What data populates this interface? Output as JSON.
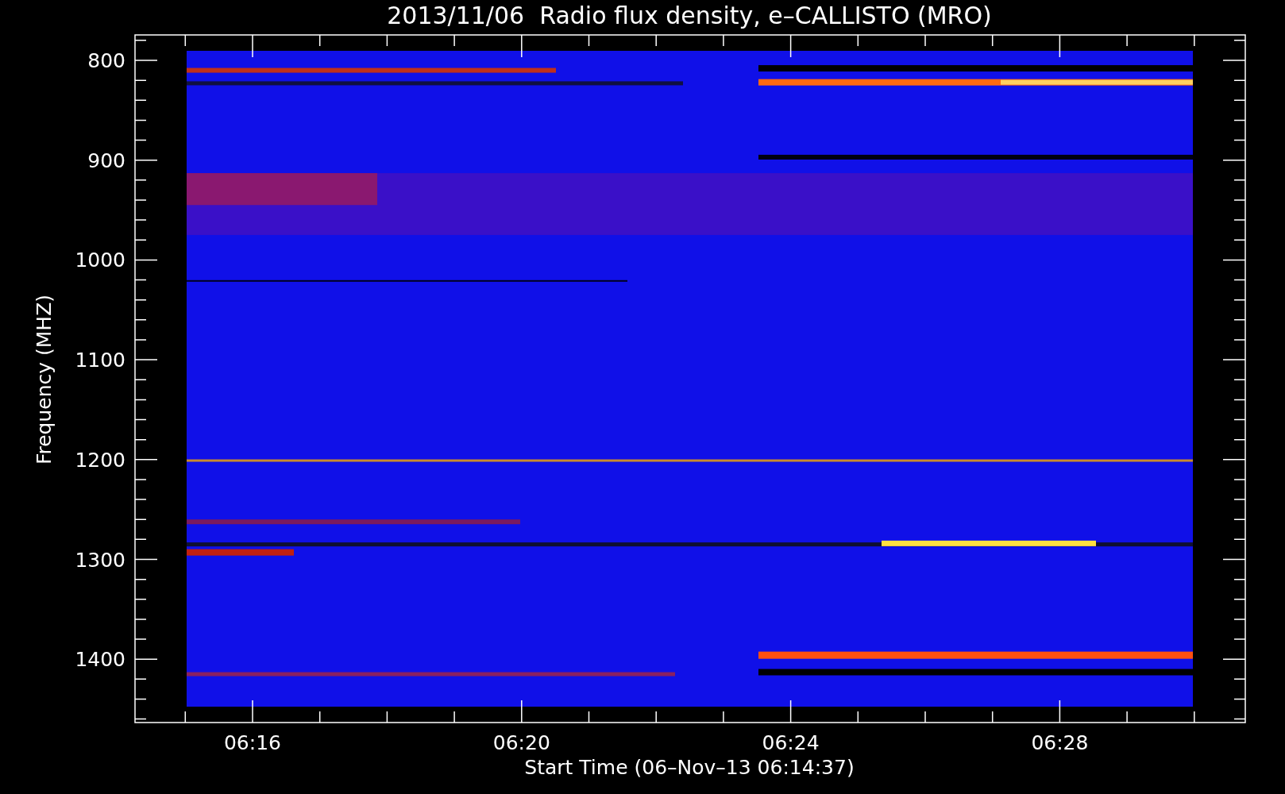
{
  "title": "2013/11/06  Radio flux density, e–CALLISTO (MRO)",
  "y_axis": {
    "label": "Frequency (MHZ)",
    "ticks": [
      "800",
      "900",
      "1000",
      "1100",
      "1200",
      "1300",
      "1400"
    ]
  },
  "x_axis": {
    "label": "Start Time (06–Nov–13 06:14:37)",
    "ticks": [
      "06:16",
      "06:20",
      "06:24",
      "06:28"
    ]
  }
}
